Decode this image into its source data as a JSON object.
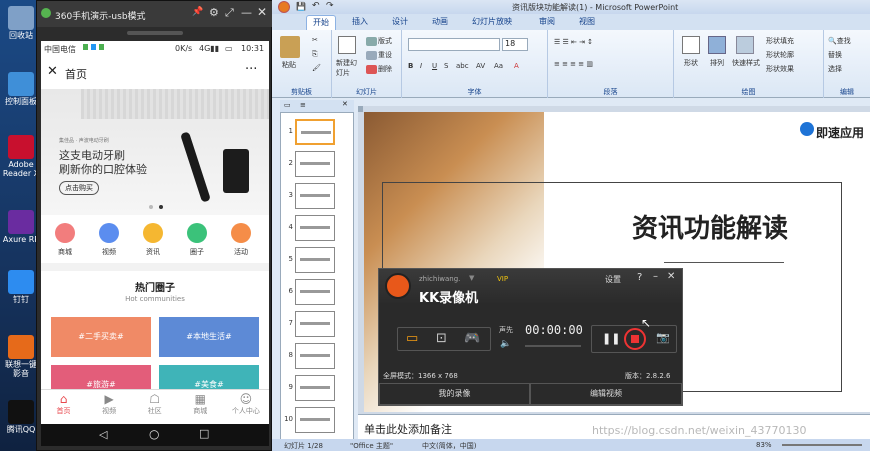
{
  "desktop": {
    "icons": [
      {
        "label": "回收站",
        "color": "#7fa0c7"
      },
      {
        "label": "控制面板",
        "color": "#3f8fd8"
      },
      {
        "label": "Adobe Reader X",
        "color": "#c8102e"
      },
      {
        "label": "Axure RP",
        "color": "#6a2ca0"
      },
      {
        "label": "钉钉",
        "color": "#2d8cf0"
      },
      {
        "label": "联想一键影音",
        "color": "#e66a1a"
      },
      {
        "label": "腾讯QQ",
        "color": "#111"
      }
    ]
  },
  "phone": {
    "window_title": "360手机演示-usb模式",
    "carrier": "中国电信",
    "net_speed": "0K/s",
    "time": "10:31",
    "header_title": "首页",
    "banner": {
      "brand": "集佳品 · 声波电动牙刷",
      "line1": "这支电动牙刷",
      "line2": "刷新你的口腔体验",
      "btn": "点击购买"
    },
    "categories": [
      {
        "label": "商城",
        "color": "#f27d7d",
        "icon": "cart-icon"
      },
      {
        "label": "视频",
        "color": "#5b8def",
        "icon": "video-icon"
      },
      {
        "label": "资讯",
        "color": "#f5b731",
        "icon": "news-icon"
      },
      {
        "label": "圈子",
        "color": "#3bc27a",
        "icon": "chat-icon"
      },
      {
        "label": "活动",
        "color": "#f58d48",
        "icon": "flag-icon"
      }
    ],
    "section_title": "热门圈子",
    "section_sub": "Hot communities",
    "cards": [
      {
        "label": "#二手买卖#",
        "color": "#f08a66"
      },
      {
        "label": "#本地生活#",
        "color": "#5d8ad6"
      },
      {
        "label": "#旅游#",
        "color": "#e35d7a"
      },
      {
        "label": "#美食#",
        "color": "#3fb4b8"
      }
    ],
    "tabbar": [
      {
        "label": "首页",
        "icon": "home-icon",
        "active": true
      },
      {
        "label": "视频",
        "icon": "video-icon",
        "active": false
      },
      {
        "label": "社区",
        "icon": "community-icon",
        "active": false
      },
      {
        "label": "商城",
        "icon": "shop-icon",
        "active": false
      },
      {
        "label": "个人中心",
        "icon": "user-icon",
        "active": false
      }
    ]
  },
  "ppt": {
    "title": "资讯版块功能解读(1) - Microsoft PowerPoint",
    "tabs": [
      "开始",
      "插入",
      "设计",
      "动画",
      "幻灯片放映",
      "审阅",
      "视图"
    ],
    "groups": {
      "clipboard": "剪贴板",
      "slides": "幻灯片",
      "font": "字体",
      "paragraph": "段落",
      "drawing": "绘图",
      "editing": "编辑"
    },
    "buttons": {
      "paste": "粘贴",
      "new_slide": "新建幻灯片",
      "layout": "版式",
      "reset": "重设",
      "delete": "删除",
      "shape": "形状",
      "arrange": "排列",
      "quick_style": "快速样式",
      "fill": "形状填充",
      "outline": "形状轮廓",
      "effect": "形状效果",
      "find": "查找",
      "replace": "替换",
      "select": "选择",
      "font_size": "18"
    },
    "slide_numbers": [
      "1",
      "2",
      "3",
      "4",
      "5",
      "6",
      "7",
      "8",
      "9",
      "10"
    ],
    "slide": {
      "heading": "资讯功能解读",
      "logo": "即速应用"
    },
    "notes": "单击此处添加备注",
    "status": {
      "slide": "幻灯片 1/28",
      "theme": "\"Office 主题\"",
      "lang": "中文(简体，中国)",
      "zoom": "83%"
    }
  },
  "kk": {
    "user": "zhichiwang.",
    "vip": "VIP",
    "settings": "设置",
    "help": "?",
    "title": "KK录像机",
    "audio": "声先",
    "timer": "00:00:00",
    "mode": "全屏模式：1366 x 768",
    "version": "版本：2.8.2.6",
    "btn_myvideo": "我的录像",
    "btn_edit": "编辑视频"
  },
  "watermark": "https://blog.csdn.net/weixin_43770130"
}
